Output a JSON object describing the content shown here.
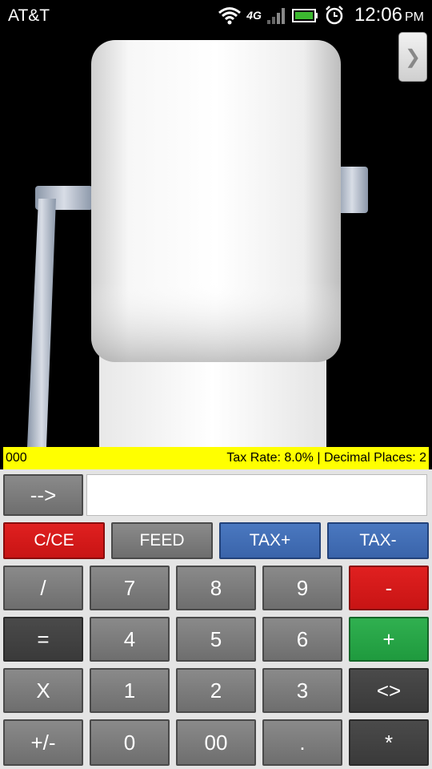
{
  "status_bar": {
    "carrier": "AT&T",
    "network": "4G",
    "time": "12:06",
    "ampm": "PM"
  },
  "info_bar": {
    "tape_value": "000",
    "tax_rate_label": "Tax Rate:",
    "tax_rate_value": "8.0%",
    "separator": "|",
    "decimal_places_label": "Decimal Places:",
    "decimal_places_value": "2"
  },
  "entry": {
    "arrow_label": "-->",
    "value": ""
  },
  "function_row": [
    "C/CE",
    "FEED",
    "TAX+",
    "TAX-"
  ],
  "keys": {
    "divide": "/",
    "k7": "7",
    "k8": "8",
    "k9": "9",
    "minus": "-",
    "equals": "=",
    "k4": "4",
    "k5": "5",
    "k6": "6",
    "plus": "+",
    "times": "X",
    "k1": "1",
    "k2": "2",
    "k3": "3",
    "swap": "<>",
    "negate": "+/-",
    "k0": "0",
    "k00": "00",
    "dot": ".",
    "multiply_star": "*"
  },
  "colors": {
    "info_bar_bg": "#ffff00",
    "red_button": "#d81818",
    "green_button": "#28a848",
    "blue_button": "#4270b8"
  }
}
